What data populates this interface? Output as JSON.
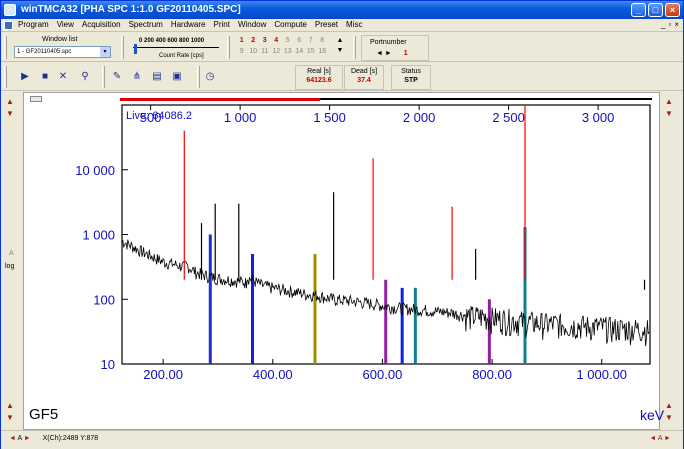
{
  "window": {
    "title": "winTMCA32   [PHA SPC 1:1.0  GF20110405.SPC]",
    "minimize_glyph": "_",
    "maximize_glyph": "□",
    "close_glyph": "×"
  },
  "menu": {
    "items": [
      "Program",
      "View",
      "Acquisition",
      "Spectrum",
      "Hardware",
      "Print",
      "Window",
      "Compute",
      "Preset",
      "Misc"
    ],
    "mdi_minimize": "_",
    "mdi_restore": "▫",
    "mdi_close": "×"
  },
  "window_list": {
    "label": "Window list",
    "selected": "1 - GF20110405.spc",
    "arrow": "▾"
  },
  "count_rate": {
    "ticks": "0  200 400 600 800 1000",
    "label": "Count Rate [cps]"
  },
  "detectors": {
    "row1": [
      "1",
      "2",
      "3",
      "4",
      "5",
      "6",
      "7",
      "8"
    ],
    "row2": [
      "9",
      "10",
      "11",
      "12",
      "13",
      "14",
      "15",
      "16"
    ],
    "active": [
      "1",
      "2",
      "3",
      "4"
    ],
    "scroll_up": "▲",
    "scroll_down": "▼"
  },
  "port": {
    "title": "Portnumber",
    "left": "◄",
    "right": "►",
    "value": "1"
  },
  "toolbar_icons": [
    "play-icon",
    "stop-icon",
    "clear-icon",
    "cursor-icon",
    "tools-icon",
    "spectrum-icon",
    "open-icon",
    "save-icon",
    "timer-icon"
  ],
  "toolbar_glyphs": [
    "▶",
    "■",
    "✕",
    "⚲",
    "✎",
    "⋔",
    "▤",
    "▣",
    "◷"
  ],
  "status": {
    "real_label": "Real [s]",
    "real_value": "64123.6",
    "dead_label": "Dead [s]",
    "dead_value": "37.4",
    "status_label": "Status",
    "status_value": "STP"
  },
  "side": {
    "up_arrow": "▲",
    "down_arrow": "▼",
    "a_label": "A",
    "log_label": "log"
  },
  "plot": {
    "sample_label": "GF5",
    "unit_label": "keV",
    "live_text": "Live: 64086.2"
  },
  "statusbar": {
    "left_arrow": "◄",
    "a_label": "A",
    "right_arrow": "►",
    "coords": "X(Ch):2489  Y:878",
    "right_controls": "◄  A  ►"
  },
  "chart_data": {
    "type": "line",
    "title": "",
    "xlabel": "keV",
    "ylabel": "",
    "y_scale": "log",
    "ylim": [
      10,
      100000
    ],
    "x_kev_range": [
      125,
      1088
    ],
    "x_kev_ticks": [
      "200.00",
      "400.00",
      "600.00",
      "800.00",
      "1 000.00"
    ],
    "x_kev_tick_values": [
      200,
      400,
      600,
      800,
      1000
    ],
    "x_channel_range": [
      340,
      3290
    ],
    "x_channel_ticks": [
      "500",
      "1 000",
      "1 500",
      "2 000",
      "2 500",
      "3 000"
    ],
    "x_channel_tick_values": [
      500,
      1000,
      1500,
      2000,
      2500,
      3000
    ],
    "y_ticks": [
      "10",
      "100",
      "1 000",
      "10 000"
    ],
    "y_tick_values": [
      10,
      100,
      1000,
      10000
    ],
    "grid": false,
    "series": [
      {
        "values_kev": [
          125,
          160,
          200,
          238,
          242,
          260,
          280,
          300,
          320,
          340,
          352,
          353,
          380,
          400,
          420,
          440,
          460,
          480,
          500,
          510,
          520,
          540,
          560,
          583,
          600,
          620,
          640,
          660,
          680,
          700,
          727,
          740,
          760,
          780,
          800,
          820,
          840,
          860,
          880,
          900,
          920,
          940,
          960,
          980,
          1000,
          1020,
          1040,
          1060,
          1075,
          1080,
          1088
        ],
        "values_counts": [
          800,
          550,
          380,
          320,
          340,
          260,
          230,
          210,
          200,
          190,
          180,
          220,
          165,
          150,
          140,
          130,
          120,
          115,
          105,
          100,
          98,
          95,
          90,
          85,
          80,
          75,
          72,
          70,
          68,
          65,
          62,
          58,
          55,
          55,
          52,
          50,
          48,
          45,
          44,
          42,
          42,
          40,
          40,
          38,
          38,
          36,
          36,
          35,
          35,
          34,
          34
        ]
      }
    ],
    "peaks": [
      {
        "kev": 238.6,
        "counts": 40000,
        "color": "#ff0000"
      },
      {
        "kev": 270,
        "counts": 1500,
        "color": "#000000"
      },
      {
        "kev": 295,
        "counts": 3000,
        "color": "#000000"
      },
      {
        "kev": 338,
        "counts": 3000,
        "color": "#000000"
      },
      {
        "kev": 511,
        "counts": 4500,
        "color": "#000000"
      },
      {
        "kev": 583,
        "counts": 15000,
        "color": "#ff0000"
      },
      {
        "kev": 727,
        "counts": 2700,
        "color": "#ff0000"
      },
      {
        "kev": 770,
        "counts": 600,
        "color": "#000000"
      },
      {
        "kev": 860,
        "counts": 120000,
        "color": "#ff0000"
      },
      {
        "kev": 1078,
        "counts": 140,
        "color": "#000000"
      }
    ],
    "roi_bars": [
      {
        "kev": 286,
        "counts": 1000,
        "color": "#2030d0"
      },
      {
        "kev": 363,
        "counts": 500,
        "color": "#1020e0"
      },
      {
        "kev": 477,
        "counts": 500,
        "color": "#a09000"
      },
      {
        "kev": 606,
        "counts": 200,
        "color": "#9020a0"
      },
      {
        "kev": 636,
        "counts": 150,
        "color": "#1020e0"
      },
      {
        "kev": 660,
        "counts": 150,
        "color": "#108090"
      },
      {
        "kev": 795,
        "counts": 100,
        "color": "#9020a0"
      },
      {
        "kev": 860,
        "counts": 1300,
        "color": "#108090"
      }
    ]
  }
}
